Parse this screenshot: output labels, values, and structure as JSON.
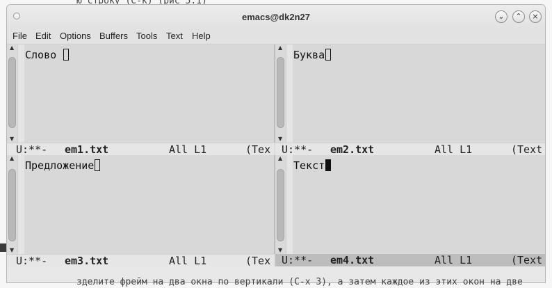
{
  "background": {
    "top_text": "ю строку (C-k) (рис 5.1)",
    "bottom_text": "зделите фрейм на два окна по вертикали (C-x 3), а затем каждое из этих окон на две"
  },
  "window": {
    "title": "emacs@dk2n27",
    "buttons": {
      "minimize": "⌄",
      "maximize": "⌃",
      "close": "×"
    }
  },
  "menubar": {
    "items": [
      "File",
      "Edit",
      "Options",
      "Buffers",
      "Tools",
      "Text",
      "Help"
    ]
  },
  "panes": [
    {
      "content": "Слово ",
      "modeline": {
        "status": "U:**-",
        "buffer": "em1.txt",
        "position": "All L1",
        "mode": "(Tex"
      }
    },
    {
      "content": "Буква",
      "modeline": {
        "status": "U:**-",
        "buffer": "em2.txt",
        "position": "All L1",
        "mode": "(Text"
      }
    },
    {
      "content": "Предложение",
      "modeline": {
        "status": "U:**-",
        "buffer": "em3.txt",
        "position": "All L1",
        "mode": "(Tex"
      }
    },
    {
      "content": "Текст",
      "modeline": {
        "status": "U:**-",
        "buffer": "em4.txt",
        "position": "All L1",
        "mode": "(Text"
      }
    }
  ],
  "colors": {
    "modeline_active": "#bdbdbd",
    "modeline_inactive": "#e6e6e6",
    "buffer_bg": "#d8d8d8"
  }
}
